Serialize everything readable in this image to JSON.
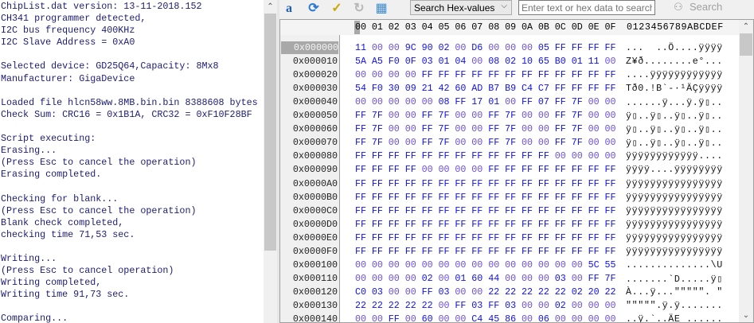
{
  "log": {
    "lines": [
      "ChipList.dat version: 13-11-2018.152",
      "CH341 programmer detected,",
      "I2C bus frequency 400KHz",
      "I2C Slave Address = 0xA0",
      "",
      "Selected device: GD25Q64,Capacity: 8Mx8",
      "Manufacturer: GigaDevice",
      "",
      "Loaded file hlcn58ww.8MB.bin.bin 8388608 bytes",
      "Check Sum: CRC16 = 0x1B1A, CRC32 = 0xF10F28BF",
      "",
      "Script executing:",
      "Erasing...",
      "(Press Esc to cancel the operation)",
      "Erasing completed.",
      "",
      "Checking for blank...",
      "(Press Esc to cancel the operation)",
      "Blank check completed,",
      "checking time 71,53 sec.",
      "",
      "Writing...",
      "(Press Esc to cancel operation)",
      "Writing completed,",
      "Writing time 91,73 sec.",
      "",
      "Comparing..."
    ]
  },
  "toolbar": {
    "icons": [
      "text-a-icon",
      "refresh-icon",
      "verify-sum-icon",
      "undo-icon",
      "calculator-icon"
    ],
    "search_type": "Search Hex-values",
    "search_placeholder": "Enter text or hex data to search for:",
    "search_label": "Search"
  },
  "hex": {
    "columns": [
      "00",
      "01",
      "02",
      "03",
      "04",
      "05",
      "06",
      "07",
      "08",
      "09",
      "0A",
      "0B",
      "0C",
      "0D",
      "0E",
      "0F"
    ],
    "ascii_header": "0123456789ABCDEF",
    "selected_address": "0x000000",
    "rows": [
      {
        "addr": "0x000000",
        "bytes": "11 00 00 9C 90 02 00 D6 00 00 00 05 FF FF FF FF",
        "ascii": "...  ..Ö....ÿÿÿÿ"
      },
      {
        "addr": "0x000010",
        "bytes": "5A A5 F0 0F 03 01 04 00 08 02 10 65 B0 01 11 00",
        "ascii": "Z¥ð........e°..."
      },
      {
        "addr": "0x000020",
        "bytes": "00 00 00 00 FF FF FF FF FF FF FF FF FF FF FF FF",
        "ascii": "....ÿÿÿÿÿÿÿÿÿÿÿÿ"
      },
      {
        "addr": "0x000030",
        "bytes": "54 F0 30 09 21 42 60 AD B7 B9 C4 C7 FF FF FF FF",
        "ascii": "Tð0.!B`-·¹ÄÇÿÿÿÿ"
      },
      {
        "addr": "0x000040",
        "bytes": "00 00 00 00 00 08 FF 17 01 00 FF 07 FF 7F 00 00",
        "ascii": "......ÿ...ÿ.ÿ▯.."
      },
      {
        "addr": "0x000050",
        "bytes": "FF 7F 00 00 FF 7F 00 00 FF 7F 00 00 FF 7F 00 00",
        "ascii": "ÿ▯..ÿ▯..ÿ▯..ÿ▯.."
      },
      {
        "addr": "0x000060",
        "bytes": "FF 7F 00 00 FF 7F 00 00 FF 7F 00 00 FF 7F 00 00",
        "ascii": "ÿ▯..ÿ▯..ÿ▯..ÿ▯.."
      },
      {
        "addr": "0x000070",
        "bytes": "FF 7F 00 00 FF 7F 00 00 FF 7F 00 00 FF 7F 00 00",
        "ascii": "ÿ▯..ÿ▯..ÿ▯..ÿ▯.."
      },
      {
        "addr": "0x000080",
        "bytes": "FF FF FF FF FF FF FF FF FF FF FF FF 00 00 00 00",
        "ascii": "ÿÿÿÿÿÿÿÿÿÿÿÿ...."
      },
      {
        "addr": "0x000090",
        "bytes": "FF FF FF FF 00 00 00 00 FF FF FF FF FF FF FF FF",
        "ascii": "ÿÿÿÿ....ÿÿÿÿÿÿÿÿ"
      },
      {
        "addr": "0x0000A0",
        "bytes": "FF FF FF FF FF FF FF FF FF FF FF FF FF FF FF FF",
        "ascii": "ÿÿÿÿÿÿÿÿÿÿÿÿÿÿÿÿ"
      },
      {
        "addr": "0x0000B0",
        "bytes": "FF FF FF FF FF FF FF FF FF FF FF FF FF FF FF FF",
        "ascii": "ÿÿÿÿÿÿÿÿÿÿÿÿÿÿÿÿ"
      },
      {
        "addr": "0x0000C0",
        "bytes": "FF FF FF FF FF FF FF FF FF FF FF FF FF FF FF FF",
        "ascii": "ÿÿÿÿÿÿÿÿÿÿÿÿÿÿÿÿ"
      },
      {
        "addr": "0x0000D0",
        "bytes": "FF FF FF FF FF FF FF FF FF FF FF FF FF FF FF FF",
        "ascii": "ÿÿÿÿÿÿÿÿÿÿÿÿÿÿÿÿ"
      },
      {
        "addr": "0x0000E0",
        "bytes": "FF FF FF FF FF FF FF FF FF FF FF FF FF FF FF FF",
        "ascii": "ÿÿÿÿÿÿÿÿÿÿÿÿÿÿÿÿ"
      },
      {
        "addr": "0x0000F0",
        "bytes": "FF FF FF FF FF FF FF FF FF FF FF FF FF FF FF FF",
        "ascii": "ÿÿÿÿÿÿÿÿÿÿÿÿÿÿÿÿ"
      },
      {
        "addr": "0x000100",
        "bytes": "00 00 00 00 00 00 00 00 00 00 00 00 00 00 5C 55",
        "ascii": "..............\\U"
      },
      {
        "addr": "0x000110",
        "bytes": "00 00 00 00 02 00 01 60 44 00 00 00 03 00 FF 7F",
        "ascii": ".......`D.....ÿ▯"
      },
      {
        "addr": "0x000120",
        "bytes": "C0 03 00 00 FF 03 00 00 22 22 22 22 22 02 20 22",
        "ascii": "À...ÿ...\"\"\"\"\". \""
      },
      {
        "addr": "0x000130",
        "bytes": "22 22 22 22 22 00 FF 03 FF 03 00 00 02 00 00 00",
        "ascii": "\"\"\"\"\".ÿ.ÿ......."
      },
      {
        "addr": "0x000140",
        "bytes": "00 00 FF 00 60 00 00 C4 45 86 00 06 00 00 00 00",
        "ascii": "..ÿ.`..ÄE ......"
      }
    ]
  },
  "colors": {
    "byte": "#1010f0",
    "zero_byte": "#6a4ee0",
    "log_text": "#1c1c78"
  }
}
